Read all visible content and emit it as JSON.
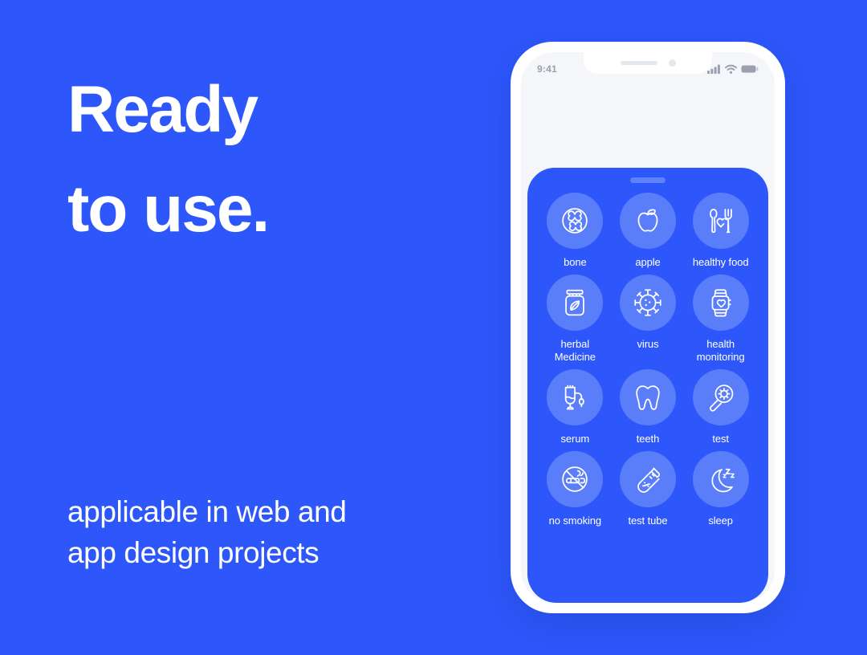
{
  "promo": {
    "headline_line_1": "Ready",
    "headline_line_2": "to use.",
    "subcopy_line_1": "applicable in web and",
    "subcopy_line_2": "app design projects"
  },
  "phone": {
    "status_bar": {
      "time": "9:41",
      "icons": [
        "cellular-signal-icon",
        "wifi-icon",
        "battery-icon"
      ]
    },
    "card": {
      "handle": "drag-handle",
      "icons": [
        {
          "id": "bone",
          "label": "bone",
          "icon": "bone-icon"
        },
        {
          "id": "apple",
          "label": "apple",
          "icon": "apple-icon"
        },
        {
          "id": "healthy-food",
          "label": "healthy food",
          "icon": "healthy-food-icon"
        },
        {
          "id": "herbal-medicine",
          "label": "herbal Medicine",
          "icon": "herbal-medicine-icon"
        },
        {
          "id": "virus",
          "label": "virus",
          "icon": "virus-icon"
        },
        {
          "id": "health-monitoring",
          "label": "health monitoring",
          "icon": "smartwatch-icon"
        },
        {
          "id": "serum",
          "label": "serum",
          "icon": "iv-drip-icon"
        },
        {
          "id": "teeth",
          "label": "teeth",
          "icon": "tooth-icon"
        },
        {
          "id": "test",
          "label": "test",
          "icon": "magnifier-virus-icon"
        },
        {
          "id": "no-smoking",
          "label": "no smoking",
          "icon": "no-smoking-icon"
        },
        {
          "id": "test-tube",
          "label": "test tube",
          "icon": "test-tube-icon"
        },
        {
          "id": "sleep",
          "label": "sleep",
          "icon": "moon-sleep-icon"
        }
      ]
    }
  },
  "colors": {
    "background_blue": "#2d57fa",
    "card_blue": "#2d57fa",
    "bubble_blue": "#5a7df9",
    "text_white": "#ffffff",
    "phone_frame": "#ffffff",
    "screen_gray": "#f4f6fa",
    "status_gray": "#9aa1ad"
  }
}
